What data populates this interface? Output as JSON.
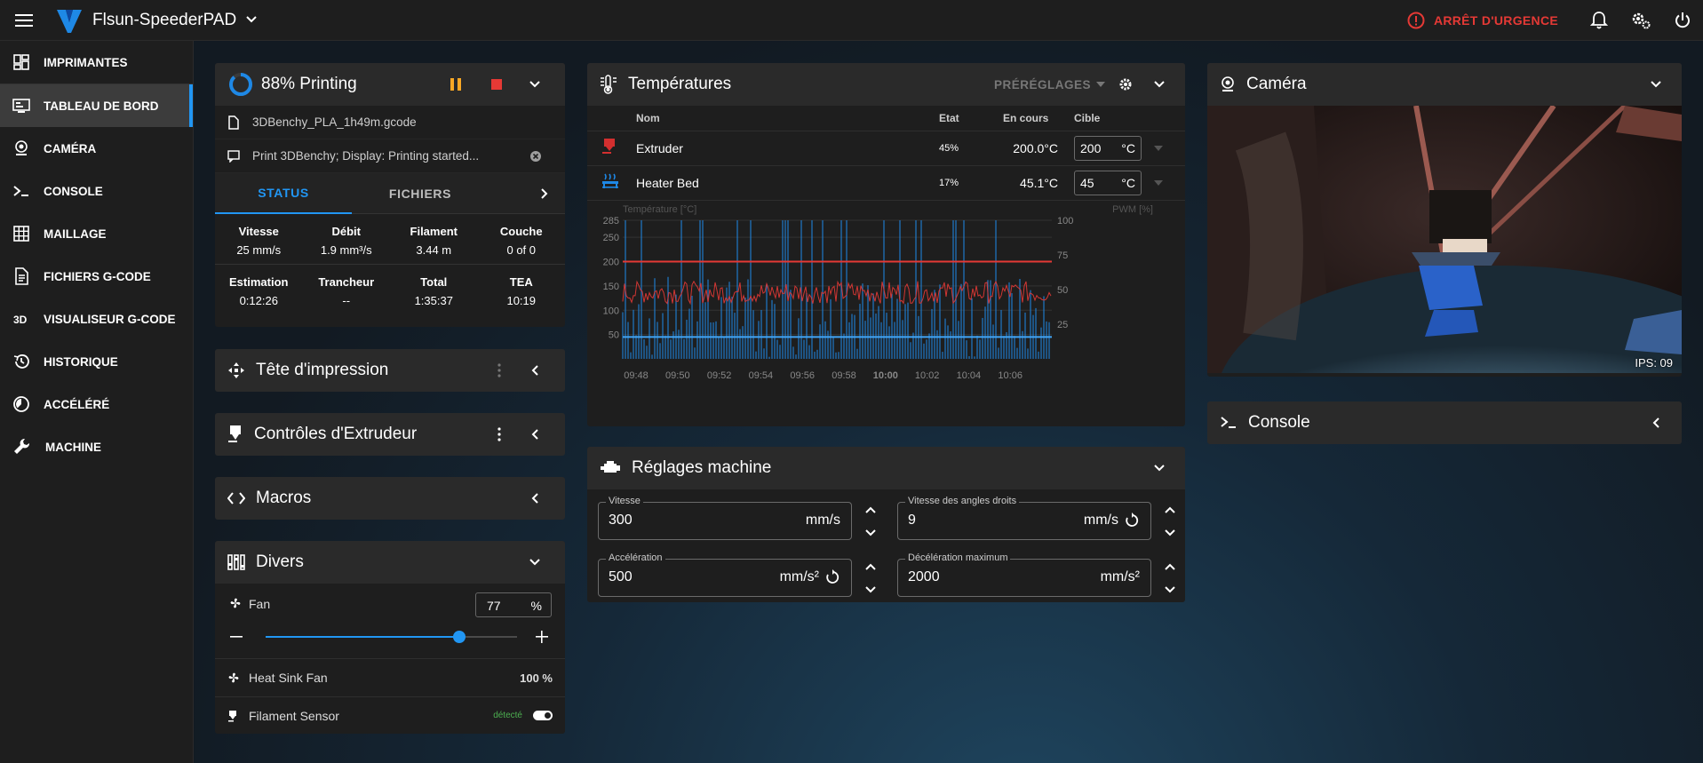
{
  "topbar": {
    "printer_name": "Flsun-SpeederPAD",
    "emergency_label": "ARRÊT D'URGENCE"
  },
  "sidebar": {
    "items": [
      {
        "label": "IMPRIMANTES",
        "icon": "printers-icon"
      },
      {
        "label": "TABLEAU DE BORD",
        "icon": "dashboard-icon"
      },
      {
        "label": "CAMÉRA",
        "icon": "webcam-icon"
      },
      {
        "label": "CONSOLE",
        "icon": "console-icon"
      },
      {
        "label": "MAILLAGE",
        "icon": "mesh-grid-icon"
      },
      {
        "label": "FICHIERS G-CODE",
        "icon": "file-document-icon"
      },
      {
        "label": "VISUALISEUR G-CODE",
        "icon": "3d-viewer-icon"
      },
      {
        "label": "HISTORIQUE",
        "icon": "history-icon"
      },
      {
        "label": "ACCÉLÉRÉ",
        "icon": "timelapse-icon"
      },
      {
        "label": "MACHINE",
        "icon": "wrench-icon"
      }
    ]
  },
  "status_panel": {
    "progress_percent": 88,
    "title": "88% Printing",
    "filename": "3DBenchy_PLA_1h49m.gcode",
    "message": "Print 3DBenchy; Display: Printing started...",
    "tabs": [
      "STATUS",
      "FICHIERS"
    ],
    "stats_row1": [
      {
        "label": "Vitesse",
        "value": "25 mm/s"
      },
      {
        "label": "Débit",
        "value": "1.9 mm³/s"
      },
      {
        "label": "Filament",
        "value": "3.44 m"
      },
      {
        "label": "Couche",
        "value": "0 of 0"
      }
    ],
    "stats_row2": [
      {
        "label": "Estimation",
        "value": "0:12:26"
      },
      {
        "label": "Trancheur",
        "value": "--"
      },
      {
        "label": "Total",
        "value": "1:35:37"
      },
      {
        "label": "TEA",
        "value": "10:19"
      }
    ]
  },
  "toolhead_panel": {
    "title": "Tête d'impression"
  },
  "extruder_panel": {
    "title": "Contrôles d'Extrudeur"
  },
  "macros_panel": {
    "title": "Macros"
  },
  "misc_panel": {
    "title": "Divers",
    "fan": {
      "label": "Fan",
      "value": "77",
      "unit": "%",
      "level": 0.77
    },
    "heat_sink_fan": {
      "label": "Heat Sink Fan",
      "value": "100 %"
    },
    "filament_sensor": {
      "label": "Filament Sensor",
      "status": "détecté",
      "enabled": true
    }
  },
  "temps_panel": {
    "title": "Températures",
    "presets_label": "PRÉRÉGLAGES",
    "headers": {
      "name": "Nom",
      "state": "Etat",
      "current": "En cours",
      "target": "Cible"
    },
    "rows": [
      {
        "name": "Extruder",
        "state": "45%",
        "current": "200.0°C",
        "target": "200",
        "unit": "°C",
        "color": "#d32f2f"
      },
      {
        "name": "Heater Bed",
        "state": "17%",
        "current": "45.1°C",
        "target": "45",
        "unit": "°C",
        "color": "#1e88e5"
      }
    ]
  },
  "chart_data": {
    "type": "line",
    "ylabel": "Température [°C]",
    "y2label": "PWM [%]",
    "ylim": [
      0,
      285
    ],
    "y2lim": [
      0,
      100
    ],
    "yticks": [
      "285",
      "250",
      "200",
      "150",
      "100",
      "50"
    ],
    "y2ticks": [
      "100",
      "75",
      "50",
      "25"
    ],
    "xticks": [
      "09:48",
      "09:50",
      "09:52",
      "09:54",
      "09:56",
      "09:58",
      "10:00",
      "10:02",
      "10:04",
      "10:06"
    ],
    "series": [
      {
        "name": "Extruder",
        "color": "#e53935",
        "values_summary": "constant ~200"
      },
      {
        "name": "Extruder PWM",
        "color": "#e53935",
        "values_summary": "oscillating ~40-55"
      },
      {
        "name": "Heater Bed",
        "color": "#2196f3",
        "values_summary": "constant ~45"
      },
      {
        "name": "Heater Bed PWM",
        "color": "#2196f3",
        "values_summary": "spiky 0-100"
      }
    ]
  },
  "machine_panel": {
    "title": "Réglages machine",
    "fields": [
      {
        "label": "Vitesse",
        "value": "300",
        "unit": "mm/s",
        "reset": false
      },
      {
        "label": "Vitesse des angles droits",
        "value": "9",
        "unit": "mm/s",
        "reset": true
      },
      {
        "label": "Accélération",
        "value": "500",
        "unit": "mm/s²",
        "reset": true
      },
      {
        "label": "Décélération maximum",
        "value": "2000",
        "unit": "mm/s²",
        "reset": false
      }
    ]
  },
  "camera_panel": {
    "title": "Caméra",
    "fps": "IPS: 09"
  },
  "console_panel": {
    "title": "Console"
  }
}
